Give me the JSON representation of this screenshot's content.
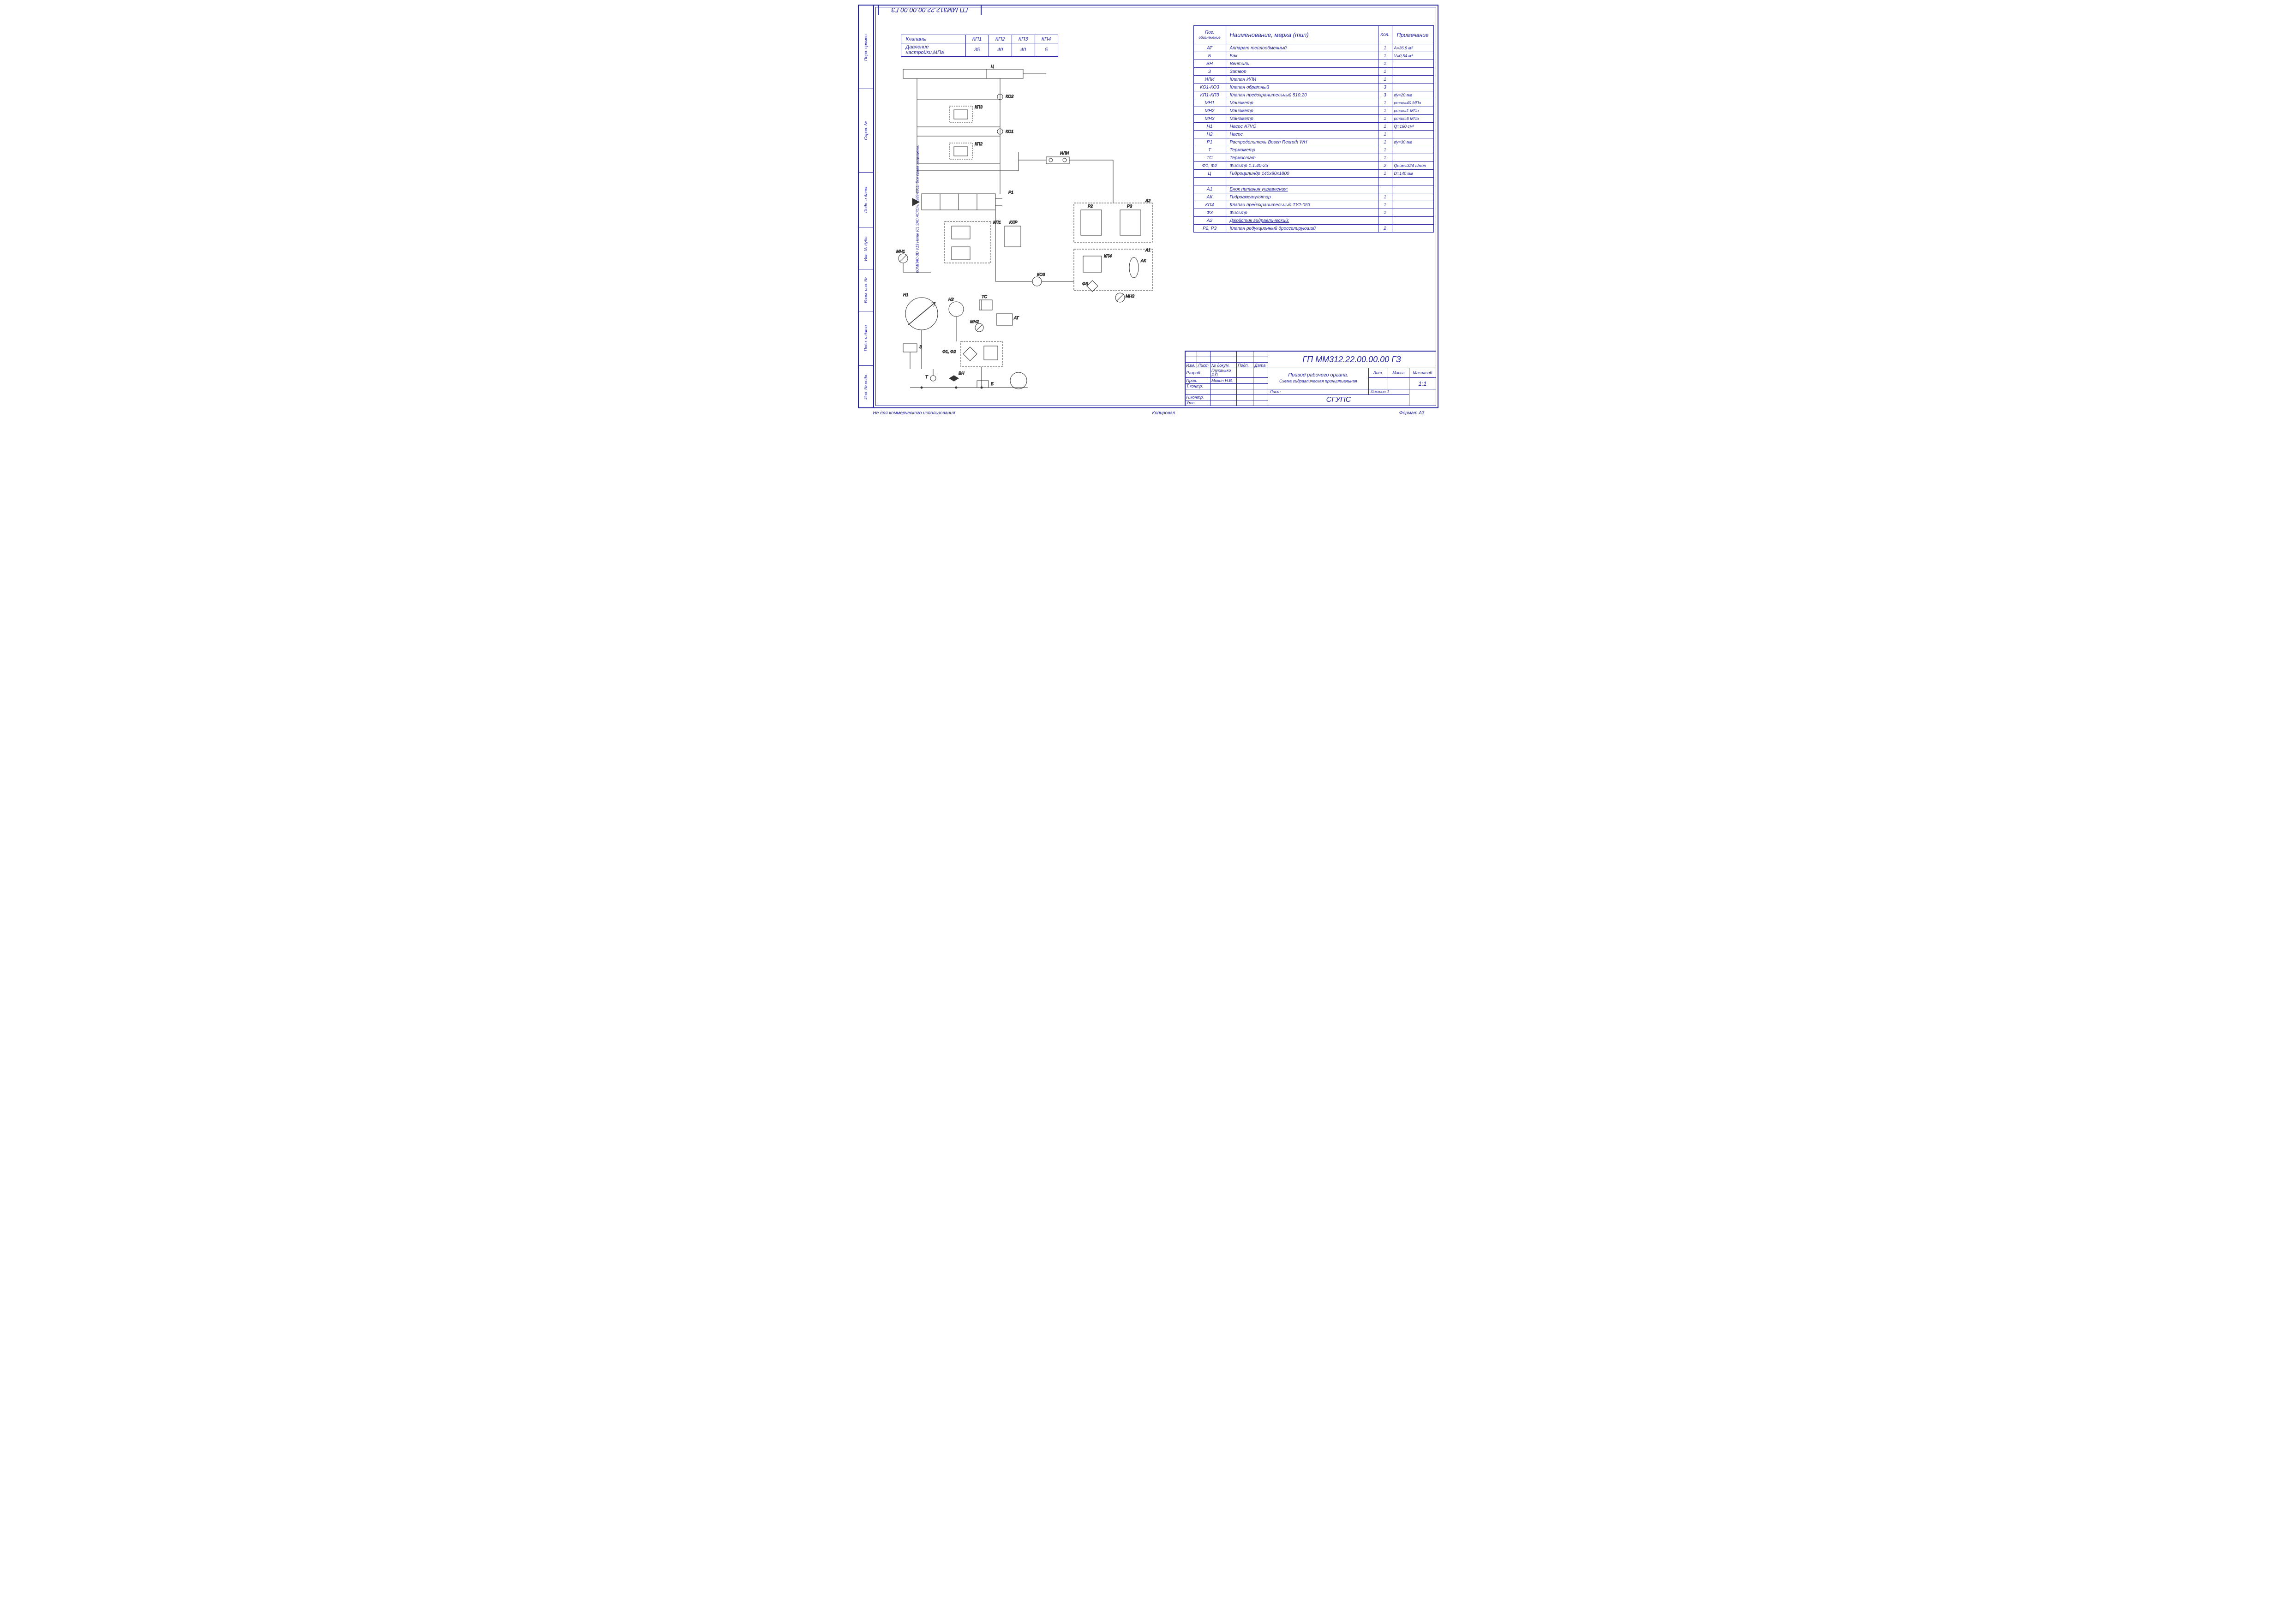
{
  "doc_code_rotated": "ГП ММ312.22.00.00.00 ГЗ",
  "valves_table": {
    "row1_label": "Клапаны",
    "row2_label": "Давление настройки,МПа",
    "headers": [
      "КП1",
      "КП2",
      "КП3",
      "КП4"
    ],
    "values": [
      "35",
      "40",
      "40",
      "5"
    ]
  },
  "parts_header": {
    "c1a": "Поз.",
    "c1b": "обозначение",
    "c2": "Наименование, марка (тип)",
    "c3": "Кол.",
    "c4": "Примечание"
  },
  "parts": [
    {
      "pos": "АТ",
      "name": "Аппарат теплообменный",
      "qty": "1",
      "note": "A=36,9 м²"
    },
    {
      "pos": "Б",
      "name": "Бак",
      "qty": "1",
      "note": "V=0,54 м³"
    },
    {
      "pos": "ВН",
      "name": "Вентиль",
      "qty": "1",
      "note": ""
    },
    {
      "pos": "З",
      "name": "Затвор",
      "qty": "1",
      "note": ""
    },
    {
      "pos": "ИЛИ",
      "name": "Клапан ИЛИ",
      "qty": "1",
      "note": ""
    },
    {
      "pos": "КО1-КО3",
      "name": "Клапан обратный",
      "qty": "3",
      "note": ""
    },
    {
      "pos": "КП1-КП3",
      "name": "Клапан предохранительный 510.20",
      "qty": "3",
      "note": "dу=20 мм"
    },
    {
      "pos": "МН1",
      "name": "Манометр",
      "qty": "1",
      "note": "pmax=40 МПа"
    },
    {
      "pos": "МН2",
      "name": "Манометр",
      "qty": "1",
      "note": "pmax=1 МПа"
    },
    {
      "pos": "МН3",
      "name": "Манометр",
      "qty": "1",
      "note": "pmax=6 МПа"
    },
    {
      "pos": "Н1",
      "name": "Насос A7VO",
      "qty": "1",
      "note": "Q=160 см³"
    },
    {
      "pos": "Н2",
      "name": "Насос",
      "qty": "1",
      "note": ""
    },
    {
      "pos": "Р1",
      "name": "Распределитель Bosch Rexroth WH",
      "qty": "1",
      "note": "dу=30 мм"
    },
    {
      "pos": "Т",
      "name": "Термометр",
      "qty": "1",
      "note": ""
    },
    {
      "pos": "ТС",
      "name": "Термостат",
      "qty": "1",
      "note": ""
    },
    {
      "pos": "Ф1, Ф2",
      "name": "Фильтр 1.1.40-25",
      "qty": "2",
      "note": "Qном=324 л/мин"
    },
    {
      "pos": "Ц",
      "name": "Гидроцилиндр 140х80х1800",
      "qty": "1",
      "note": "D=140 мм"
    },
    {
      "pos": "",
      "name": "",
      "qty": "",
      "note": ""
    },
    {
      "pos": "А1",
      "name": "Блок питания управления:",
      "qty": "",
      "note": "",
      "u": true
    },
    {
      "pos": "АК",
      "name": "Гидроаккумулятор",
      "qty": "1",
      "note": ""
    },
    {
      "pos": "КП4",
      "name": "Клапан предохранительный ТУ2-053",
      "qty": "1",
      "note": ""
    },
    {
      "pos": "Ф3",
      "name": "Фильтр",
      "qty": "1",
      "note": ""
    },
    {
      "pos": "А2",
      "name": "Джойстик гидравлический:",
      "qty": "",
      "note": "",
      "u": true
    },
    {
      "pos": "Р2, Р3",
      "name": "Клапан редукционный дросселирующий",
      "qty": "2",
      "note": ""
    }
  ],
  "title_block": {
    "doc_number": "ГП ММ312.22.00.00.00 ГЗ",
    "title_line1": "Привод рабочего органа.",
    "title_line2": "Схема гидравлическая принципиальная",
    "headers": {
      "izm": "Изм.",
      "list": "Лист",
      "ndoc": "№ докум.",
      "podp": "Подп.",
      "data": "Дата"
    },
    "rows": {
      "razrab": "Разраб.",
      "razrab_name": "Глуханько Р.П.",
      "prov": "Пров.",
      "prov_name": "Мокин Н.В.",
      "tkontr": "Т.контр.",
      "nkontr": "Н.контр.",
      "utv": "Утв."
    },
    "lit": "Лит.",
    "massa": "Масса",
    "mashtab": "Масштаб",
    "scale": "1:1",
    "list": "Лист",
    "listov": "Листов    1",
    "org": "СГУПС"
  },
  "labels": {
    "Ц": "Ц",
    "КО1": "КО1",
    "КО2": "КО2",
    "КП2": "КП2",
    "КП3": "КП3",
    "ИЛИ": "ИЛИ",
    "Р1": "Р1",
    "КП1": "КП1",
    "КЛР": "КЛР",
    "А2": "А2",
    "Р2": "Р2",
    "Р3": "Р3",
    "КП4": "КП4",
    "А1": "А1",
    "АК": "АК",
    "Ф3": "Ф3",
    "КО3": "КО3",
    "МН1": "МН1",
    "МН2": "МН2",
    "МН3": "МН3",
    "Н1": "Н1",
    "Н2": "Н2",
    "ТС": "ТС",
    "АТ": "АТ",
    "Ф1Ф2": "Ф1, Ф2",
    "Т": "Т",
    "ВН": "ВН",
    "Б": "Б",
    "З": "З"
  },
  "side_labels": {
    "perv": "Перв. примен.",
    "sprav": "Справ. №",
    "podp1": "Подп. и дата",
    "vzam": "Взам. инв. №",
    "invd": "Инв. № дубл.",
    "podp2": "Подп. и дата",
    "invp": "Инв. № подл."
  },
  "copyright": "КОМПАС-3D V13 Home (C) ЗАО АСКОН, 1989-2011. Все права защищены.",
  "bottom_note": "Не для коммерческого использования",
  "bottom_center": "Копировал",
  "bottom_right": "Формат    A3"
}
